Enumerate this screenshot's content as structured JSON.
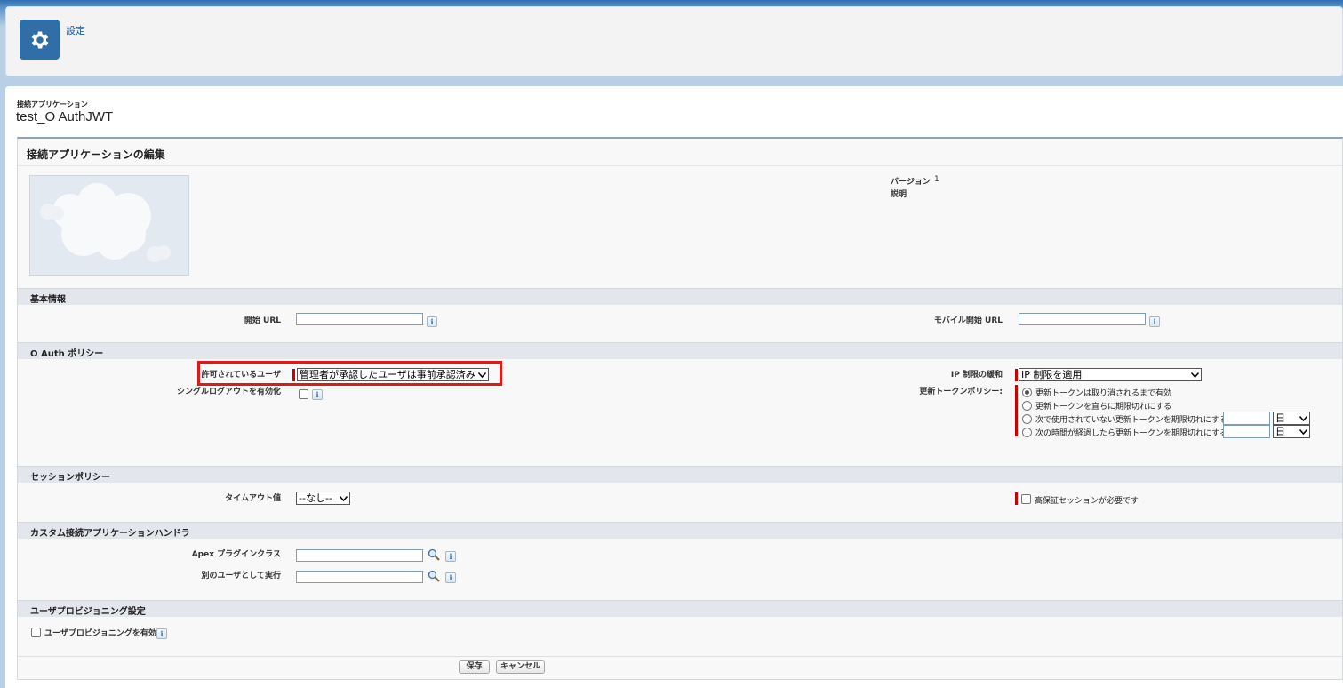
{
  "header": {
    "title": "設定",
    "icon": "gear-icon"
  },
  "object": {
    "type_label": "接続アプリケーション",
    "name": "test_O AuthJWT"
  },
  "panel": {
    "title": "接続アプリケーションの編集"
  },
  "meta": {
    "version_label": "バージョン",
    "version_value": "1",
    "description_label": "説明"
  },
  "sections": {
    "basic": "基本情報",
    "oauth": "O Auth ポリシー",
    "session": "セッションポリシー",
    "custom": "カスタム接続アプリケーションハンドラ",
    "provisioning": "ユーザプロビジョニング設定"
  },
  "basic": {
    "start_url_label": "開始 URL",
    "start_url_value": "",
    "mobile_start_url_label": "モバイル開始 URL",
    "mobile_start_url_value": ""
  },
  "oauth": {
    "permitted_users_label": "許可されているユーザ",
    "permitted_users_value": "管理者が承認したユーザは事前承認済み",
    "single_logout_label": "シングルログアウトを有効化",
    "ip_relax_label": "IP 制限の緩和",
    "ip_relax_value": "IP 制限を適用",
    "refresh_policy_label": "更新トークンポリシー:",
    "refresh_options": [
      "更新トークンは取り消されるまで有効",
      "更新トークンを直ちに期限切れにする",
      "次で使用されていない更新トークンを期限切れにする",
      "次の時間が経過したら更新トークンを期限切れにする"
    ],
    "refresh_selected_index": 0,
    "unit_value": "日"
  },
  "session": {
    "timeout_label": "タイムアウト値",
    "timeout_value": "--なし--",
    "high_assurance_label": "高保証セッションが必要です"
  },
  "custom": {
    "apex_label": "Apex プラグインクラス",
    "apex_value": "",
    "run_as_label": "別のユーザとして実行",
    "run_as_value": ""
  },
  "provisioning": {
    "enable_label": "ユーザプロビジョニングを有効化"
  },
  "buttons": {
    "save": "保存",
    "cancel": "キャンセル"
  },
  "colors": {
    "required": "#cc0000",
    "highlight": "#e01818",
    "header_icon_bg": "#2f6ea6"
  }
}
